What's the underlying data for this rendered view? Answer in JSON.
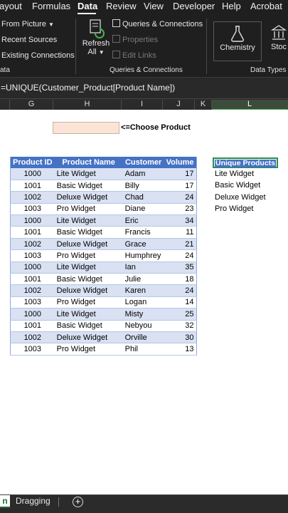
{
  "menu": {
    "tabs": [
      "ayout",
      "Formulas",
      "Data",
      "Review",
      "View",
      "Developer",
      "Help",
      "Acrobat"
    ],
    "active": "Data"
  },
  "ribbon": {
    "get_data": {
      "from_picture": "From Picture",
      "recent_sources": "Recent Sources",
      "existing_connections": "Existing Connections",
      "group_label": "ata"
    },
    "queries": {
      "refresh_all_line1": "Refresh",
      "refresh_all_line2": "All",
      "queries_connections": "Queries & Connections",
      "properties": "Properties",
      "edit_links": "Edit Links",
      "group_label": "Queries & Connections"
    },
    "data_types": {
      "chemistry": "Chemistry",
      "stocks": "Stoc",
      "group_label": "Data Types"
    }
  },
  "formula_bar": {
    "formula": "=UNIQUE(Customer_Product[Product Name])"
  },
  "columns": [
    "G",
    "H",
    "I",
    "J",
    "K",
    "L"
  ],
  "sheet": {
    "choose_label": "<=Choose Product",
    "table": {
      "headers": [
        "Product ID",
        "Product Name",
        "Customer",
        "Volume"
      ],
      "rows": [
        [
          "1000",
          "Lite Widget",
          "Adam",
          "17"
        ],
        [
          "1001",
          "Basic Widget",
          "Billy",
          "17"
        ],
        [
          "1002",
          "Deluxe Widget",
          "Chad",
          "24"
        ],
        [
          "1003",
          "Pro Widget",
          "Diane",
          "23"
        ],
        [
          "1000",
          "Lite Widget",
          "Eric",
          "34"
        ],
        [
          "1001",
          "Basic Widget",
          "Francis",
          "11"
        ],
        [
          "1002",
          "Deluxe Widget",
          "Grace",
          "21"
        ],
        [
          "1003",
          "Pro Widget",
          "Humphrey",
          "24"
        ],
        [
          "1000",
          "Lite Widget",
          "Ian",
          "35"
        ],
        [
          "1001",
          "Basic Widget",
          "Julie",
          "18"
        ],
        [
          "1002",
          "Deluxe Widget",
          "Karen",
          "24"
        ],
        [
          "1003",
          "Pro Widget",
          "Logan",
          "14"
        ],
        [
          "1000",
          "Lite Widget",
          "Misty",
          "25"
        ],
        [
          "1001",
          "Basic Widget",
          "Nebyou",
          "32"
        ],
        [
          "1002",
          "Deluxe Widget",
          "Orville",
          "30"
        ],
        [
          "1003",
          "Pro Widget",
          "Phil",
          "13"
        ]
      ]
    },
    "unique": {
      "header": "Unique Products",
      "items": [
        "Lite Widget",
        "Basic Widget",
        "Deluxe Widget",
        "Pro Widget"
      ]
    }
  },
  "sheet_tabs": {
    "active_fragment": "n",
    "other": "Dragging"
  },
  "colors": {
    "table_header": "#4472c4",
    "band": "#d9e1f2",
    "input_cell": "#fbe3d6",
    "ribbon_bg": "#1f1f1f",
    "selection": "#2a8e4a"
  }
}
